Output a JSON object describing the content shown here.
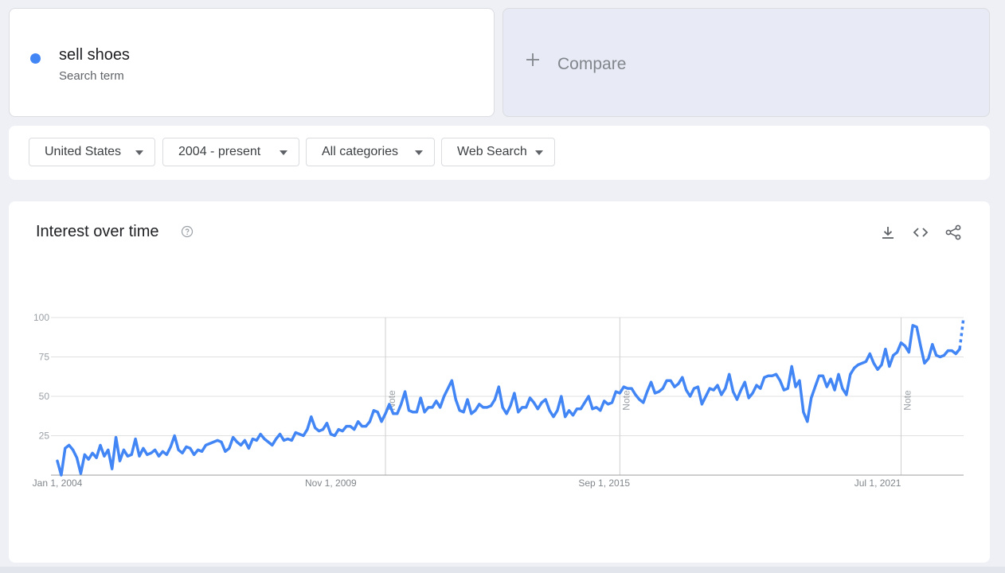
{
  "term": {
    "name": "sell shoes",
    "sublabel": "Search term",
    "color": "#4285f4"
  },
  "compare": {
    "plus_icon": "plus-icon",
    "label": "Compare"
  },
  "filters": [
    {
      "label": "United States"
    },
    {
      "label": "2004 - present"
    },
    {
      "label": "All categories"
    },
    {
      "label": "Web Search"
    }
  ],
  "chart_section": {
    "title": "Interest over time",
    "help_icon": "help-circle-icon",
    "tools": [
      "download-icon",
      "embed-code-icon",
      "share-icon"
    ]
  },
  "chart_data": {
    "type": "line",
    "title": "",
    "xlabel": "",
    "ylabel": "",
    "ylim": [
      0,
      100
    ],
    "y_ticks": [
      "100",
      "75",
      "50",
      "25"
    ],
    "x_range": [
      "2004-01",
      "2023-05"
    ],
    "x_ticks": [
      {
        "label": "Jan 1, 2004",
        "date": "2004-01"
      },
      {
        "label": "Nov 1, 2009",
        "date": "2009-11"
      },
      {
        "label": "Sep 1, 2015",
        "date": "2015-09"
      },
      {
        "label": "Jul 1, 2021",
        "date": "2021-07"
      }
    ],
    "notes": [
      {
        "label": "Note",
        "date": "2011-01"
      },
      {
        "label": "Note",
        "date": "2016-01"
      },
      {
        "label": "Note",
        "date": "2022-01"
      }
    ],
    "grid": true,
    "series": [
      {
        "name": "sell shoes",
        "color": "#4285f4",
        "partial_tail_points": 2,
        "points": [
          [
            "2004-01",
            9
          ],
          [
            "2004-02",
            0
          ],
          [
            "2004-03",
            17
          ],
          [
            "2004-04",
            19
          ],
          [
            "2004-05",
            16
          ],
          [
            "2004-06",
            11
          ],
          [
            "2004-07",
            1
          ],
          [
            "2004-08",
            13
          ],
          [
            "2004-09",
            10
          ],
          [
            "2004-10",
            14
          ],
          [
            "2004-11",
            11
          ],
          [
            "2004-12",
            19
          ],
          [
            "2005-01",
            12
          ],
          [
            "2005-02",
            16
          ],
          [
            "2005-03",
            4
          ],
          [
            "2005-04",
            24
          ],
          [
            "2005-05",
            9
          ],
          [
            "2005-06",
            16
          ],
          [
            "2005-07",
            12
          ],
          [
            "2005-08",
            13
          ],
          [
            "2005-09",
            23
          ],
          [
            "2005-10",
            12
          ],
          [
            "2005-11",
            17
          ],
          [
            "2005-12",
            13
          ],
          [
            "2006-01",
            14
          ],
          [
            "2006-02",
            16
          ],
          [
            "2006-03",
            12
          ],
          [
            "2006-04",
            15
          ],
          [
            "2006-05",
            13
          ],
          [
            "2006-06",
            18
          ],
          [
            "2006-07",
            25
          ],
          [
            "2006-08",
            16
          ],
          [
            "2006-09",
            14
          ],
          [
            "2006-10",
            18
          ],
          [
            "2006-11",
            17
          ],
          [
            "2006-12",
            13
          ],
          [
            "2007-01",
            16
          ],
          [
            "2007-02",
            15
          ],
          [
            "2007-03",
            19
          ],
          [
            "2007-04",
            20
          ],
          [
            "2007-05",
            21
          ],
          [
            "2007-06",
            22
          ],
          [
            "2007-07",
            21
          ],
          [
            "2007-08",
            15
          ],
          [
            "2007-09",
            17
          ],
          [
            "2007-10",
            24
          ],
          [
            "2007-11",
            21
          ],
          [
            "2007-12",
            19
          ],
          [
            "2008-01",
            22
          ],
          [
            "2008-02",
            17
          ],
          [
            "2008-03",
            23
          ],
          [
            "2008-04",
            22
          ],
          [
            "2008-05",
            26
          ],
          [
            "2008-06",
            23
          ],
          [
            "2008-07",
            21
          ],
          [
            "2008-08",
            19
          ],
          [
            "2008-09",
            23
          ],
          [
            "2008-10",
            26
          ],
          [
            "2008-11",
            22
          ],
          [
            "2008-12",
            23
          ],
          [
            "2009-01",
            22
          ],
          [
            "2009-02",
            27
          ],
          [
            "2009-03",
            26
          ],
          [
            "2009-04",
            25
          ],
          [
            "2009-05",
            29
          ],
          [
            "2009-06",
            37
          ],
          [
            "2009-07",
            30
          ],
          [
            "2009-08",
            28
          ],
          [
            "2009-09",
            29
          ],
          [
            "2009-10",
            33
          ],
          [
            "2009-11",
            26
          ],
          [
            "2009-12",
            25
          ],
          [
            "2010-01",
            29
          ],
          [
            "2010-02",
            28
          ],
          [
            "2010-03",
            31
          ],
          [
            "2010-04",
            31
          ],
          [
            "2010-05",
            29
          ],
          [
            "2010-06",
            34
          ],
          [
            "2010-07",
            31
          ],
          [
            "2010-08",
            31
          ],
          [
            "2010-09",
            34
          ],
          [
            "2010-10",
            41
          ],
          [
            "2010-11",
            40
          ],
          [
            "2010-12",
            34
          ],
          [
            "2011-01",
            39
          ],
          [
            "2011-02",
            45
          ],
          [
            "2011-03",
            39
          ],
          [
            "2011-04",
            39
          ],
          [
            "2011-05",
            45
          ],
          [
            "2011-06",
            53
          ],
          [
            "2011-07",
            41
          ],
          [
            "2011-08",
            40
          ],
          [
            "2011-09",
            40
          ],
          [
            "2011-10",
            49
          ],
          [
            "2011-11",
            40
          ],
          [
            "2011-12",
            43
          ],
          [
            "2012-01",
            43
          ],
          [
            "2012-02",
            47
          ],
          [
            "2012-03",
            43
          ],
          [
            "2012-04",
            50
          ],
          [
            "2012-05",
            55
          ],
          [
            "2012-06",
            60
          ],
          [
            "2012-07",
            48
          ],
          [
            "2012-08",
            41
          ],
          [
            "2012-09",
            40
          ],
          [
            "2012-10",
            48
          ],
          [
            "2012-11",
            39
          ],
          [
            "2012-12",
            41
          ],
          [
            "2013-01",
            45
          ],
          [
            "2013-02",
            43
          ],
          [
            "2013-03",
            43
          ],
          [
            "2013-04",
            44
          ],
          [
            "2013-05",
            48
          ],
          [
            "2013-06",
            56
          ],
          [
            "2013-07",
            43
          ],
          [
            "2013-08",
            39
          ],
          [
            "2013-09",
            44
          ],
          [
            "2013-10",
            52
          ],
          [
            "2013-11",
            40
          ],
          [
            "2013-12",
            43
          ],
          [
            "2014-01",
            43
          ],
          [
            "2014-02",
            49
          ],
          [
            "2014-03",
            46
          ],
          [
            "2014-04",
            42
          ],
          [
            "2014-05",
            46
          ],
          [
            "2014-06",
            48
          ],
          [
            "2014-07",
            41
          ],
          [
            "2014-08",
            37
          ],
          [
            "2014-09",
            41
          ],
          [
            "2014-10",
            50
          ],
          [
            "2014-11",
            37
          ],
          [
            "2014-12",
            41
          ],
          [
            "2015-01",
            38
          ],
          [
            "2015-02",
            42
          ],
          [
            "2015-03",
            42
          ],
          [
            "2015-04",
            46
          ],
          [
            "2015-05",
            50
          ],
          [
            "2015-06",
            42
          ],
          [
            "2015-07",
            43
          ],
          [
            "2015-08",
            41
          ],
          [
            "2015-09",
            47
          ],
          [
            "2015-10",
            45
          ],
          [
            "2015-11",
            46
          ],
          [
            "2015-12",
            53
          ],
          [
            "2016-01",
            52
          ],
          [
            "2016-02",
            56
          ],
          [
            "2016-03",
            55
          ],
          [
            "2016-04",
            55
          ],
          [
            "2016-05",
            51
          ],
          [
            "2016-06",
            48
          ],
          [
            "2016-07",
            46
          ],
          [
            "2016-08",
            53
          ],
          [
            "2016-09",
            59
          ],
          [
            "2016-10",
            52
          ],
          [
            "2016-11",
            53
          ],
          [
            "2016-12",
            55
          ],
          [
            "2017-01",
            60
          ],
          [
            "2017-02",
            60
          ],
          [
            "2017-03",
            56
          ],
          [
            "2017-04",
            58
          ],
          [
            "2017-05",
            62
          ],
          [
            "2017-06",
            54
          ],
          [
            "2017-07",
            50
          ],
          [
            "2017-08",
            55
          ],
          [
            "2017-09",
            56
          ],
          [
            "2017-10",
            45
          ],
          [
            "2017-11",
            50
          ],
          [
            "2017-12",
            55
          ],
          [
            "2018-01",
            54
          ],
          [
            "2018-02",
            57
          ],
          [
            "2018-03",
            51
          ],
          [
            "2018-04",
            55
          ],
          [
            "2018-05",
            64
          ],
          [
            "2018-06",
            53
          ],
          [
            "2018-07",
            48
          ],
          [
            "2018-08",
            54
          ],
          [
            "2018-09",
            59
          ],
          [
            "2018-10",
            49
          ],
          [
            "2018-11",
            52
          ],
          [
            "2018-12",
            57
          ],
          [
            "2019-01",
            55
          ],
          [
            "2019-02",
            62
          ],
          [
            "2019-03",
            63
          ],
          [
            "2019-04",
            63
          ],
          [
            "2019-05",
            64
          ],
          [
            "2019-06",
            60
          ],
          [
            "2019-07",
            54
          ],
          [
            "2019-08",
            55
          ],
          [
            "2019-09",
            69
          ],
          [
            "2019-10",
            56
          ],
          [
            "2019-11",
            60
          ],
          [
            "2019-12",
            40
          ],
          [
            "2020-01",
            34
          ],
          [
            "2020-02",
            49
          ],
          [
            "2020-03",
            56
          ],
          [
            "2020-04",
            63
          ],
          [
            "2020-05",
            63
          ],
          [
            "2020-06",
            56
          ],
          [
            "2020-07",
            61
          ],
          [
            "2020-08",
            54
          ],
          [
            "2020-09",
            64
          ],
          [
            "2020-10",
            55
          ],
          [
            "2020-11",
            51
          ],
          [
            "2020-12",
            64
          ],
          [
            "2021-01",
            68
          ],
          [
            "2021-02",
            70
          ],
          [
            "2021-03",
            71
          ],
          [
            "2021-04",
            72
          ],
          [
            "2021-05",
            77
          ],
          [
            "2021-06",
            71
          ],
          [
            "2021-07",
            67
          ],
          [
            "2021-08",
            70
          ],
          [
            "2021-09",
            80
          ],
          [
            "2021-10",
            69
          ],
          [
            "2021-11",
            76
          ],
          [
            "2021-12",
            78
          ],
          [
            "2022-01",
            84
          ],
          [
            "2022-02",
            82
          ],
          [
            "2022-03",
            78
          ],
          [
            "2022-04",
            95
          ],
          [
            "2022-05",
            94
          ],
          [
            "2022-06",
            82
          ],
          [
            "2022-07",
            71
          ],
          [
            "2022-08",
            74
          ],
          [
            "2022-09",
            83
          ],
          [
            "2022-10",
            76
          ],
          [
            "2022-11",
            75
          ],
          [
            "2022-12",
            76
          ],
          [
            "2023-01",
            79
          ],
          [
            "2023-02",
            79
          ],
          [
            "2023-03",
            77
          ],
          [
            "2023-04",
            80
          ],
          [
            "2023-05",
            100
          ]
        ]
      }
    ]
  }
}
